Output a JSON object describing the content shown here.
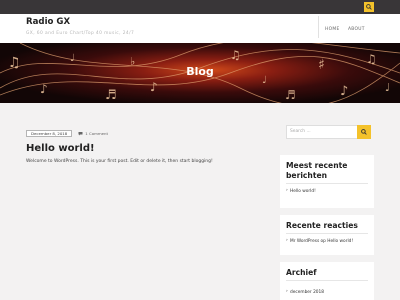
{
  "site": {
    "title": "Radio GX",
    "description": "GX, 60 and Euro Chart/Top 40 music, 24/7"
  },
  "nav": {
    "items": [
      {
        "label": "HOME"
      },
      {
        "label": "ABOUT"
      }
    ]
  },
  "hero": {
    "title": "Blog"
  },
  "post": {
    "date": "December 8, 2018",
    "comments": "1 Comment",
    "title": "Hello world!",
    "body": "Welcome to WordPress. This is your first post. Edit or delete it, then start blogging!"
  },
  "sidebar": {
    "search_placeholder": "Search ...",
    "recent_posts": {
      "title": "Meest recente berichten",
      "items": [
        "Hello world!"
      ]
    },
    "recent_comments": {
      "title": "Recente reacties",
      "items": [
        "Mr WordPress op Hello world!"
      ]
    },
    "archive": {
      "title": "Archief",
      "items": [
        "december 2018"
      ]
    }
  },
  "colors": {
    "accent": "#f4c22b",
    "topbar": "#393638",
    "background": "#f3f2f2"
  },
  "icons": {
    "search": "search-icon",
    "comment": "comment-icon"
  }
}
